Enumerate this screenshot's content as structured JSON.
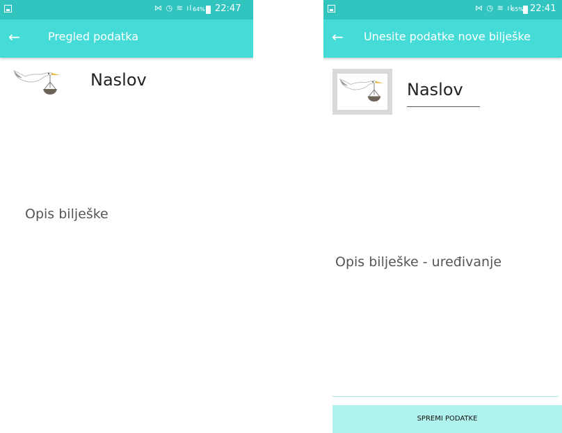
{
  "left_screen": {
    "status_bar": {
      "icons": "⋈ ◷ ≋ ıl",
      "battery": "64%",
      "time": "22:47"
    },
    "app_bar": {
      "title": "Pregled podatka"
    },
    "note": {
      "title": "Naslov",
      "description": "Opis bilješke"
    }
  },
  "right_screen": {
    "status_bar": {
      "icons": "⋈ ◷ ≋ ıl",
      "battery": "65%",
      "time": "22:41"
    },
    "app_bar": {
      "title": "Unesite podatke nove bilješke"
    },
    "note": {
      "title": "Naslov",
      "description": "Opis bilješke - uređivanje"
    },
    "save_button": {
      "label": "SPREMI PODATKE"
    }
  },
  "icons": {
    "back": "arrow-left-icon",
    "image": "stork-scale-icon"
  },
  "colors": {
    "status_bar": "#32c5c0",
    "app_bar": "#45dcd7",
    "save_button": "#b0f3ee"
  }
}
